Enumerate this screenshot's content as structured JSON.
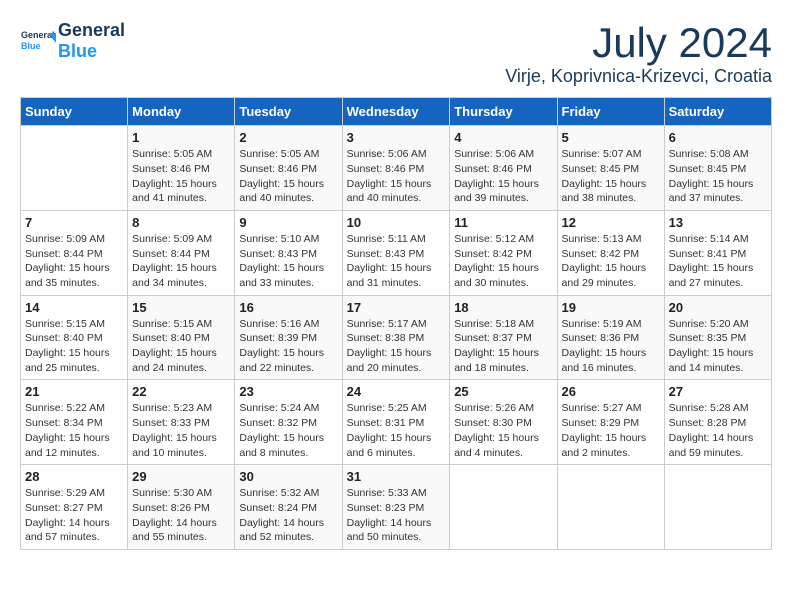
{
  "header": {
    "logo_general": "General",
    "logo_blue": "Blue",
    "month": "July 2024",
    "location": "Virje, Koprivnica-Krizevci, Croatia"
  },
  "weekdays": [
    "Sunday",
    "Monday",
    "Tuesday",
    "Wednesday",
    "Thursday",
    "Friday",
    "Saturday"
  ],
  "weeks": [
    [
      {
        "day": "",
        "sunrise": "",
        "sunset": "",
        "daylight": ""
      },
      {
        "day": "1",
        "sunrise": "Sunrise: 5:05 AM",
        "sunset": "Sunset: 8:46 PM",
        "daylight": "Daylight: 15 hours and 41 minutes."
      },
      {
        "day": "2",
        "sunrise": "Sunrise: 5:05 AM",
        "sunset": "Sunset: 8:46 PM",
        "daylight": "Daylight: 15 hours and 40 minutes."
      },
      {
        "day": "3",
        "sunrise": "Sunrise: 5:06 AM",
        "sunset": "Sunset: 8:46 PM",
        "daylight": "Daylight: 15 hours and 40 minutes."
      },
      {
        "day": "4",
        "sunrise": "Sunrise: 5:06 AM",
        "sunset": "Sunset: 8:46 PM",
        "daylight": "Daylight: 15 hours and 39 minutes."
      },
      {
        "day": "5",
        "sunrise": "Sunrise: 5:07 AM",
        "sunset": "Sunset: 8:45 PM",
        "daylight": "Daylight: 15 hours and 38 minutes."
      },
      {
        "day": "6",
        "sunrise": "Sunrise: 5:08 AM",
        "sunset": "Sunset: 8:45 PM",
        "daylight": "Daylight: 15 hours and 37 minutes."
      }
    ],
    [
      {
        "day": "7",
        "sunrise": "Sunrise: 5:09 AM",
        "sunset": "Sunset: 8:44 PM",
        "daylight": "Daylight: 15 hours and 35 minutes."
      },
      {
        "day": "8",
        "sunrise": "Sunrise: 5:09 AM",
        "sunset": "Sunset: 8:44 PM",
        "daylight": "Daylight: 15 hours and 34 minutes."
      },
      {
        "day": "9",
        "sunrise": "Sunrise: 5:10 AM",
        "sunset": "Sunset: 8:43 PM",
        "daylight": "Daylight: 15 hours and 33 minutes."
      },
      {
        "day": "10",
        "sunrise": "Sunrise: 5:11 AM",
        "sunset": "Sunset: 8:43 PM",
        "daylight": "Daylight: 15 hours and 31 minutes."
      },
      {
        "day": "11",
        "sunrise": "Sunrise: 5:12 AM",
        "sunset": "Sunset: 8:42 PM",
        "daylight": "Daylight: 15 hours and 30 minutes."
      },
      {
        "day": "12",
        "sunrise": "Sunrise: 5:13 AM",
        "sunset": "Sunset: 8:42 PM",
        "daylight": "Daylight: 15 hours and 29 minutes."
      },
      {
        "day": "13",
        "sunrise": "Sunrise: 5:14 AM",
        "sunset": "Sunset: 8:41 PM",
        "daylight": "Daylight: 15 hours and 27 minutes."
      }
    ],
    [
      {
        "day": "14",
        "sunrise": "Sunrise: 5:15 AM",
        "sunset": "Sunset: 8:40 PM",
        "daylight": "Daylight: 15 hours and 25 minutes."
      },
      {
        "day": "15",
        "sunrise": "Sunrise: 5:15 AM",
        "sunset": "Sunset: 8:40 PM",
        "daylight": "Daylight: 15 hours and 24 minutes."
      },
      {
        "day": "16",
        "sunrise": "Sunrise: 5:16 AM",
        "sunset": "Sunset: 8:39 PM",
        "daylight": "Daylight: 15 hours and 22 minutes."
      },
      {
        "day": "17",
        "sunrise": "Sunrise: 5:17 AM",
        "sunset": "Sunset: 8:38 PM",
        "daylight": "Daylight: 15 hours and 20 minutes."
      },
      {
        "day": "18",
        "sunrise": "Sunrise: 5:18 AM",
        "sunset": "Sunset: 8:37 PM",
        "daylight": "Daylight: 15 hours and 18 minutes."
      },
      {
        "day": "19",
        "sunrise": "Sunrise: 5:19 AM",
        "sunset": "Sunset: 8:36 PM",
        "daylight": "Daylight: 15 hours and 16 minutes."
      },
      {
        "day": "20",
        "sunrise": "Sunrise: 5:20 AM",
        "sunset": "Sunset: 8:35 PM",
        "daylight": "Daylight: 15 hours and 14 minutes."
      }
    ],
    [
      {
        "day": "21",
        "sunrise": "Sunrise: 5:22 AM",
        "sunset": "Sunset: 8:34 PM",
        "daylight": "Daylight: 15 hours and 12 minutes."
      },
      {
        "day": "22",
        "sunrise": "Sunrise: 5:23 AM",
        "sunset": "Sunset: 8:33 PM",
        "daylight": "Daylight: 15 hours and 10 minutes."
      },
      {
        "day": "23",
        "sunrise": "Sunrise: 5:24 AM",
        "sunset": "Sunset: 8:32 PM",
        "daylight": "Daylight: 15 hours and 8 minutes."
      },
      {
        "day": "24",
        "sunrise": "Sunrise: 5:25 AM",
        "sunset": "Sunset: 8:31 PM",
        "daylight": "Daylight: 15 hours and 6 minutes."
      },
      {
        "day": "25",
        "sunrise": "Sunrise: 5:26 AM",
        "sunset": "Sunset: 8:30 PM",
        "daylight": "Daylight: 15 hours and 4 minutes."
      },
      {
        "day": "26",
        "sunrise": "Sunrise: 5:27 AM",
        "sunset": "Sunset: 8:29 PM",
        "daylight": "Daylight: 15 hours and 2 minutes."
      },
      {
        "day": "27",
        "sunrise": "Sunrise: 5:28 AM",
        "sunset": "Sunset: 8:28 PM",
        "daylight": "Daylight: 14 hours and 59 minutes."
      }
    ],
    [
      {
        "day": "28",
        "sunrise": "Sunrise: 5:29 AM",
        "sunset": "Sunset: 8:27 PM",
        "daylight": "Daylight: 14 hours and 57 minutes."
      },
      {
        "day": "29",
        "sunrise": "Sunrise: 5:30 AM",
        "sunset": "Sunset: 8:26 PM",
        "daylight": "Daylight: 14 hours and 55 minutes."
      },
      {
        "day": "30",
        "sunrise": "Sunrise: 5:32 AM",
        "sunset": "Sunset: 8:24 PM",
        "daylight": "Daylight: 14 hours and 52 minutes."
      },
      {
        "day": "31",
        "sunrise": "Sunrise: 5:33 AM",
        "sunset": "Sunset: 8:23 PM",
        "daylight": "Daylight: 14 hours and 50 minutes."
      },
      {
        "day": "",
        "sunrise": "",
        "sunset": "",
        "daylight": ""
      },
      {
        "day": "",
        "sunrise": "",
        "sunset": "",
        "daylight": ""
      },
      {
        "day": "",
        "sunrise": "",
        "sunset": "",
        "daylight": ""
      }
    ]
  ]
}
